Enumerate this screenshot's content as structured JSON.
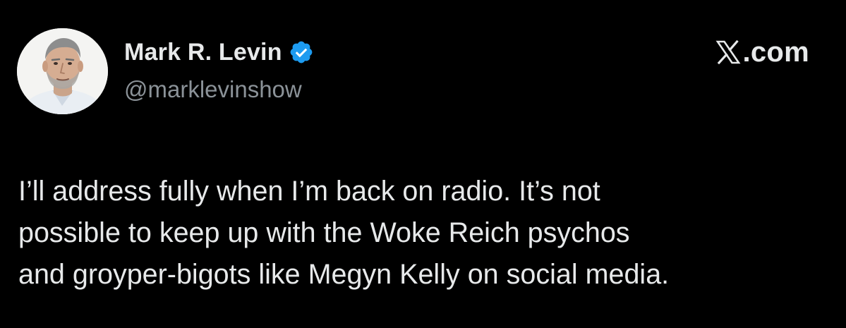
{
  "tweet": {
    "author": {
      "name": "Mark R. Levin",
      "handle": "@marklevinshow",
      "verified": true,
      "avatar_icon": "profile-photo"
    },
    "site": {
      "logo_icon": "x-logo-icon",
      "label": ".com"
    },
    "text_lines": [
      "I’ll address fully when I’m back on radio. It’s not",
      "possible to keep up with the Woke Reich psychos",
      "and groyper-bigots like Megyn Kelly on social media."
    ]
  },
  "colors": {
    "background": "#000000",
    "text_primary": "#e7e9ea",
    "text_secondary": "#8b9298",
    "verified_blue": "#1d9bf0"
  }
}
